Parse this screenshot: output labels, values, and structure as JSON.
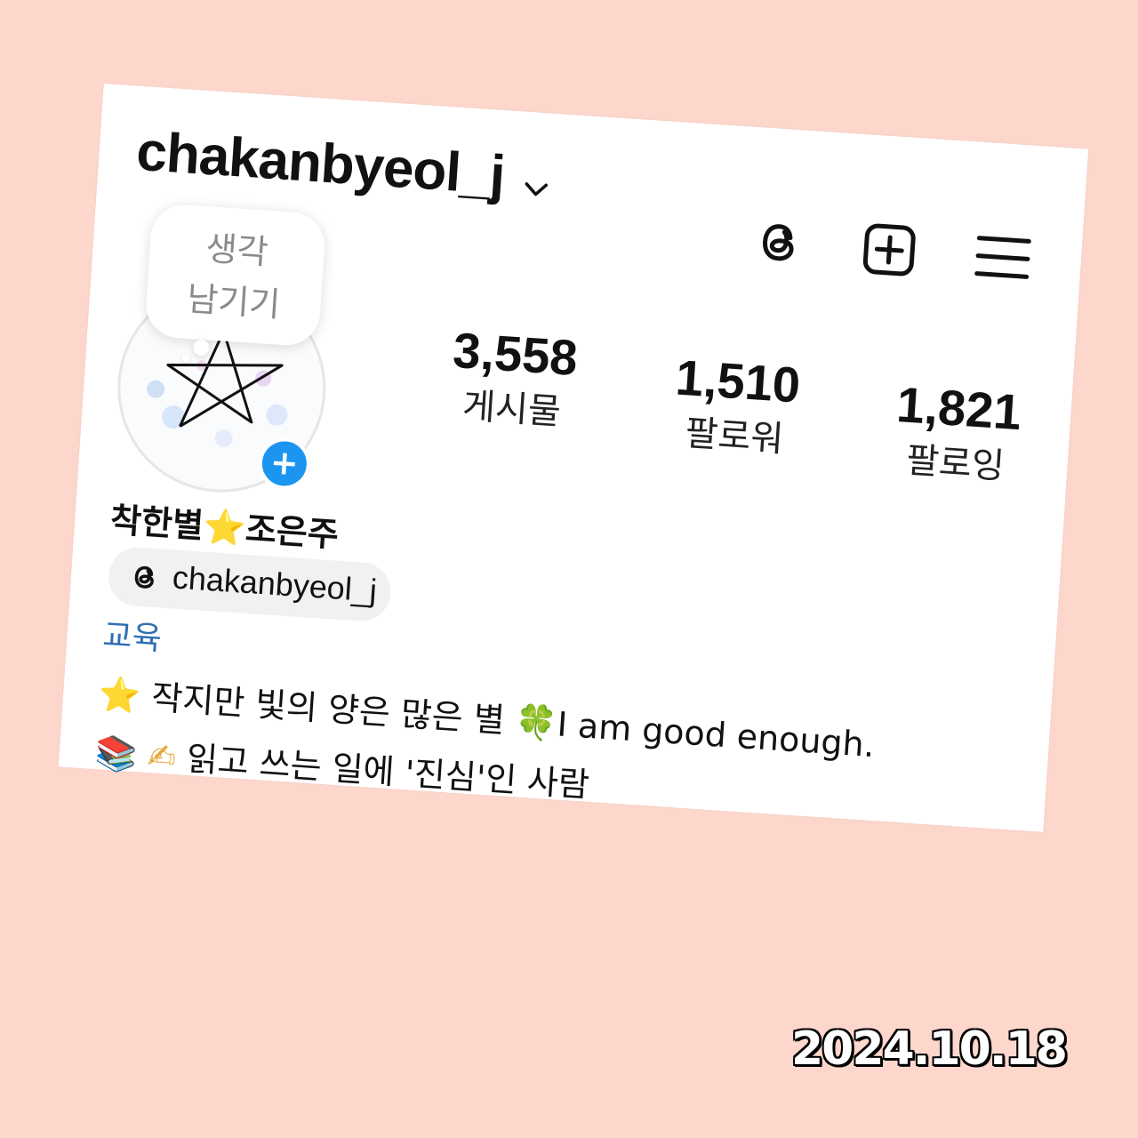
{
  "profile": {
    "username": "chakanbyeol_j",
    "display_name_part1": "착한별",
    "display_name_star": "⭐",
    "display_name_part2": "조은주",
    "threads_handle": "chakanbyeol_j",
    "category": "교육"
  },
  "note": {
    "line1": "생각",
    "line2": "남기기"
  },
  "stats": [
    {
      "value": "3,558",
      "label": "게시물"
    },
    {
      "value": "1,510",
      "label": "팔로워"
    },
    {
      "value": "1,821",
      "label": "팔로잉"
    }
  ],
  "bio": {
    "line1_emoji": "⭐",
    "line1_text": "작지만 빛의 양은 많은 별",
    "line1_emoji2": "🍀",
    "line1_text2": "I am good enough.",
    "line2_emoji1": "📚",
    "line2_emoji2": "✍",
    "line2_text": "읽고 쓰는 일에 '진심'인 사람"
  },
  "icons": {
    "username_dropdown": "chevron-down-icon",
    "threads": "threads-icon",
    "new_post": "plus-square-icon",
    "menu": "hamburger-menu-icon",
    "add_story": "plus-circle-icon"
  },
  "colors": {
    "background": "#fdd6cc",
    "accent_blue": "#1b95f0",
    "category_text": "#2f6fb2"
  },
  "date_stamp": "2024.10.18"
}
